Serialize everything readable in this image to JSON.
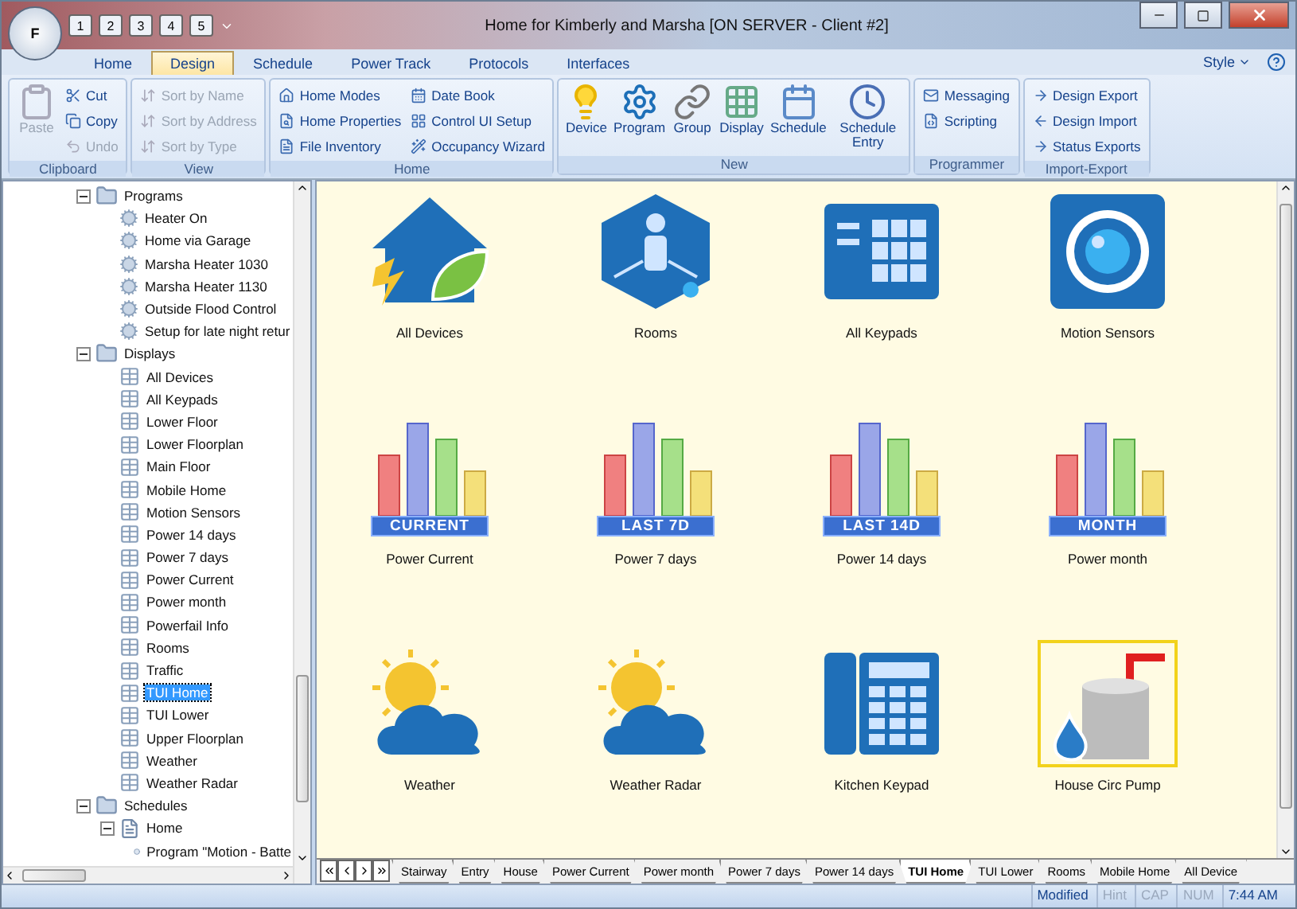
{
  "window": {
    "title": "Home for Kimberly and Marsha [ON SERVER - Client #2]",
    "app_button": "F",
    "quick_access": [
      "1",
      "2",
      "3",
      "4",
      "5"
    ]
  },
  "ribbon_tabs": [
    {
      "label": "Home",
      "selected": false
    },
    {
      "label": "Design",
      "selected": true
    },
    {
      "label": "Schedule",
      "selected": false
    },
    {
      "label": "Power Track",
      "selected": false
    },
    {
      "label": "Protocols",
      "selected": false
    },
    {
      "label": "Interfaces",
      "selected": false
    }
  ],
  "style_menu": "Style",
  "ribbon_groups": [
    {
      "label": "Clipboard",
      "items": [
        {
          "label": "Paste",
          "kind": "large",
          "disabled": true
        },
        {
          "label": "Cut",
          "kind": "small",
          "disabled": false
        },
        {
          "label": "Copy",
          "kind": "small",
          "disabled": false
        },
        {
          "label": "Undo",
          "kind": "small",
          "disabled": true
        }
      ]
    },
    {
      "label": "View",
      "items": [
        {
          "label": "Sort by Name",
          "kind": "small",
          "disabled": true
        },
        {
          "label": "Sort by Address",
          "kind": "small",
          "disabled": true
        },
        {
          "label": "Sort by Type",
          "kind": "small",
          "disabled": true
        }
      ]
    },
    {
      "label": "Home",
      "items": [
        {
          "label": "Home Modes",
          "kind": "small",
          "disabled": false
        },
        {
          "label": "Home Properties",
          "kind": "small",
          "disabled": false
        },
        {
          "label": "File Inventory",
          "kind": "small",
          "disabled": false
        },
        {
          "label": "Date Book",
          "kind": "small",
          "disabled": false
        },
        {
          "label": "Control UI Setup",
          "kind": "small",
          "disabled": false
        },
        {
          "label": "Occupancy Wizard",
          "kind": "small",
          "disabled": false
        }
      ]
    },
    {
      "label": "New",
      "items": [
        {
          "label": "Device",
          "kind": "large",
          "disabled": false
        },
        {
          "label": "Program",
          "kind": "large",
          "disabled": false
        },
        {
          "label": "Group",
          "kind": "large",
          "disabled": false
        },
        {
          "label": "Display",
          "kind": "large",
          "disabled": false
        },
        {
          "label": "Schedule",
          "kind": "large",
          "disabled": false
        },
        {
          "label": "Schedule Entry",
          "kind": "large",
          "disabled": false
        }
      ]
    },
    {
      "label": "Programmer",
      "items": [
        {
          "label": "Messaging",
          "kind": "small",
          "disabled": false
        },
        {
          "label": "Scripting",
          "kind": "small",
          "disabled": false
        }
      ]
    },
    {
      "label": "Import-Export",
      "items": [
        {
          "label": "Design Export",
          "kind": "small",
          "disabled": false
        },
        {
          "label": "Design Import",
          "kind": "small",
          "disabled": false
        },
        {
          "label": "Status Exports",
          "kind": "small",
          "disabled": false
        }
      ]
    }
  ],
  "tree": [
    {
      "label": "Programs",
      "kind": "folder",
      "expanded": true,
      "selected": false,
      "children": [
        {
          "label": "Heater On",
          "kind": "program",
          "selected": false
        },
        {
          "label": "Home via Garage",
          "kind": "program",
          "selected": false
        },
        {
          "label": "Marsha Heater 1030",
          "kind": "program",
          "selected": false
        },
        {
          "label": "Marsha Heater 1130",
          "kind": "program",
          "selected": false
        },
        {
          "label": "Outside Flood Control",
          "kind": "program",
          "selected": false
        },
        {
          "label": "Setup for late night retur",
          "kind": "program",
          "selected": false
        }
      ]
    },
    {
      "label": "Displays",
      "kind": "folder",
      "expanded": true,
      "selected": false,
      "children": [
        {
          "label": "All Devices",
          "kind": "display",
          "selected": false
        },
        {
          "label": "All Keypads",
          "kind": "display",
          "selected": false
        },
        {
          "label": "Lower Floor",
          "kind": "display",
          "selected": false
        },
        {
          "label": "Lower Floorplan",
          "kind": "display",
          "selected": false
        },
        {
          "label": "Main Floor",
          "kind": "display",
          "selected": false
        },
        {
          "label": "Mobile Home",
          "kind": "display",
          "selected": false
        },
        {
          "label": "Motion Sensors",
          "kind": "display",
          "selected": false
        },
        {
          "label": "Power 14 days",
          "kind": "display",
          "selected": false
        },
        {
          "label": "Power 7 days",
          "kind": "display",
          "selected": false
        },
        {
          "label": "Power Current",
          "kind": "display",
          "selected": false
        },
        {
          "label": "Power month",
          "kind": "display",
          "selected": false
        },
        {
          "label": "Powerfail Info",
          "kind": "display",
          "selected": false
        },
        {
          "label": "Rooms",
          "kind": "display",
          "selected": false
        },
        {
          "label": "Traffic",
          "kind": "display",
          "selected": false
        },
        {
          "label": "TUI Home",
          "kind": "display",
          "selected": true
        },
        {
          "label": "TUI Lower",
          "kind": "display",
          "selected": false
        },
        {
          "label": "Upper Floorplan",
          "kind": "display",
          "selected": false
        },
        {
          "label": "Weather",
          "kind": "display",
          "selected": false
        },
        {
          "label": "Weather Radar",
          "kind": "display",
          "selected": false
        }
      ]
    },
    {
      "label": "Schedules",
      "kind": "folder",
      "expanded": true,
      "selected": false,
      "children": [
        {
          "label": "Home",
          "kind": "schedule",
          "expanded": true,
          "selected": false,
          "children": [
            {
              "label": "Program \"Motion - Batte",
              "kind": "entry",
              "selected": false
            }
          ]
        }
      ]
    }
  ],
  "tiles": [
    {
      "label": "All Devices",
      "kind": "house",
      "selected": false
    },
    {
      "label": "Rooms",
      "kind": "rooms",
      "selected": false
    },
    {
      "label": "All Keypads",
      "kind": "keypad",
      "selected": false
    },
    {
      "label": "Motion Sensors",
      "kind": "camera",
      "selected": false
    },
    {
      "label": "Power Current",
      "kind": "power",
      "badge": "CURRENT",
      "selected": false
    },
    {
      "label": "Power 7 days",
      "kind": "power",
      "badge": "LAST 7D",
      "selected": false
    },
    {
      "label": "Power 14 days",
      "kind": "power",
      "badge": "LAST 14D",
      "selected": false
    },
    {
      "label": "Power month",
      "kind": "power",
      "badge": "MONTH",
      "selected": false
    },
    {
      "label": "Weather",
      "kind": "weather",
      "selected": false
    },
    {
      "label": "Weather Radar",
      "kind": "weather",
      "selected": false
    },
    {
      "label": "Kitchen Keypad",
      "kind": "phone",
      "selected": false
    },
    {
      "label": "House Circ Pump",
      "kind": "pump",
      "selected": true
    }
  ],
  "sheet_tabs": [
    {
      "label": "Stairway",
      "selected": false
    },
    {
      "label": "Entry",
      "selected": false
    },
    {
      "label": "House",
      "selected": false
    },
    {
      "label": "Power Current",
      "selected": false
    },
    {
      "label": "Power month",
      "selected": false
    },
    {
      "label": "Power 7 days",
      "selected": false
    },
    {
      "label": "Power 14 days",
      "selected": false
    },
    {
      "label": "TUI Home",
      "selected": true
    },
    {
      "label": "TUI Lower",
      "selected": false
    },
    {
      "label": "Rooms",
      "selected": false
    },
    {
      "label": "Mobile Home",
      "selected": false
    },
    {
      "label": "All Device",
      "selected": false
    }
  ],
  "status_bar": [
    {
      "label": "Modified",
      "active": true
    },
    {
      "label": "Hint",
      "active": false
    },
    {
      "label": "CAP",
      "active": false
    },
    {
      "label": "NUM",
      "active": false
    },
    {
      "label": "7:44 AM",
      "active": true
    }
  ]
}
